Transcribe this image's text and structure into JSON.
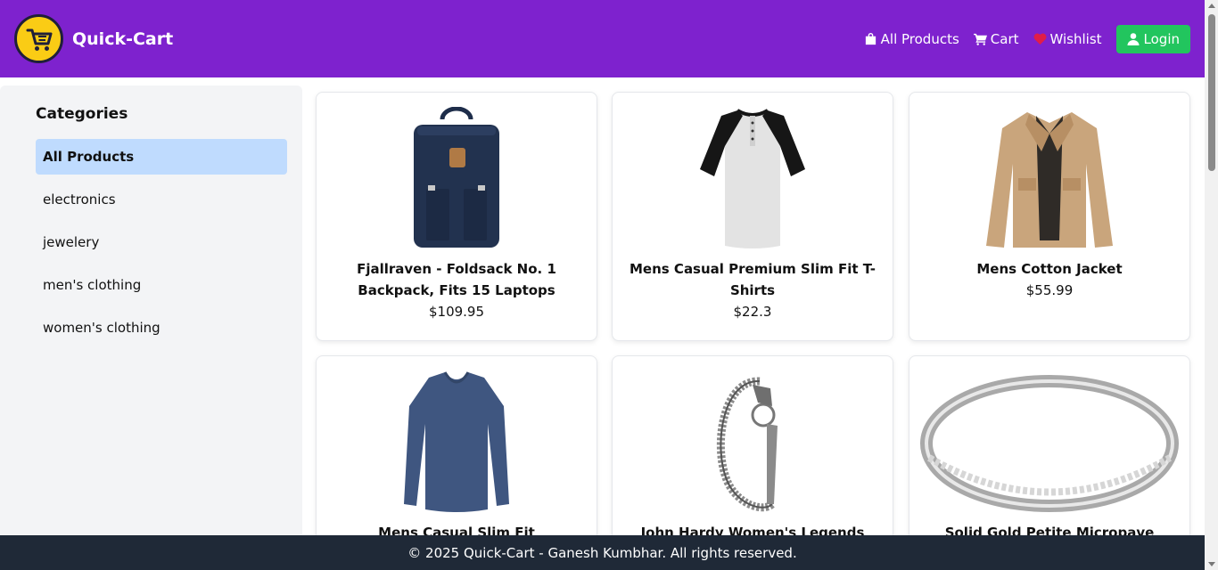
{
  "brand": {
    "name": "Quick-Cart",
    "logo_icon": "cart-logo-icon"
  },
  "nav": {
    "links": [
      {
        "label": "All Products",
        "icon": "shopping-bag-icon"
      },
      {
        "label": "Cart",
        "icon": "cart-icon"
      },
      {
        "label": "Wishlist",
        "icon": "heart-icon"
      }
    ],
    "login_label": "Login"
  },
  "sidebar": {
    "title": "Categories",
    "items": [
      {
        "label": "All Products",
        "active": true
      },
      {
        "label": "electronics"
      },
      {
        "label": "jewelery"
      },
      {
        "label": "men's clothing"
      },
      {
        "label": "women's clothing"
      }
    ]
  },
  "products": [
    {
      "title": "Fjallraven - Foldsack No. 1 Backpack, Fits 15 Laptops",
      "price": "$109.95",
      "image": "backpack-image"
    },
    {
      "title": "Mens Casual Premium Slim Fit T-Shirts",
      "price": "$22.3",
      "image": "tshirt-image"
    },
    {
      "title": "Mens Cotton Jacket",
      "price": "$55.99",
      "image": "jacket-image"
    },
    {
      "title": "Mens Casual Slim Fit",
      "price": "",
      "image": "longsleeve-image"
    },
    {
      "title": "John Hardy Women's Legends Naga",
      "price": "",
      "image": "bracelet-image"
    },
    {
      "title": "Solid Gold Petite Micropave",
      "price": "",
      "image": "ring-image"
    }
  ],
  "footer": {
    "text": "© 2025 Quick-Cart - Ganesh Kumbhar. All rights reserved."
  },
  "colors": {
    "navbar": "#7e22ce",
    "login": "#22c55e",
    "footer": "#1f2937",
    "active_category": "#bfdbfe"
  }
}
